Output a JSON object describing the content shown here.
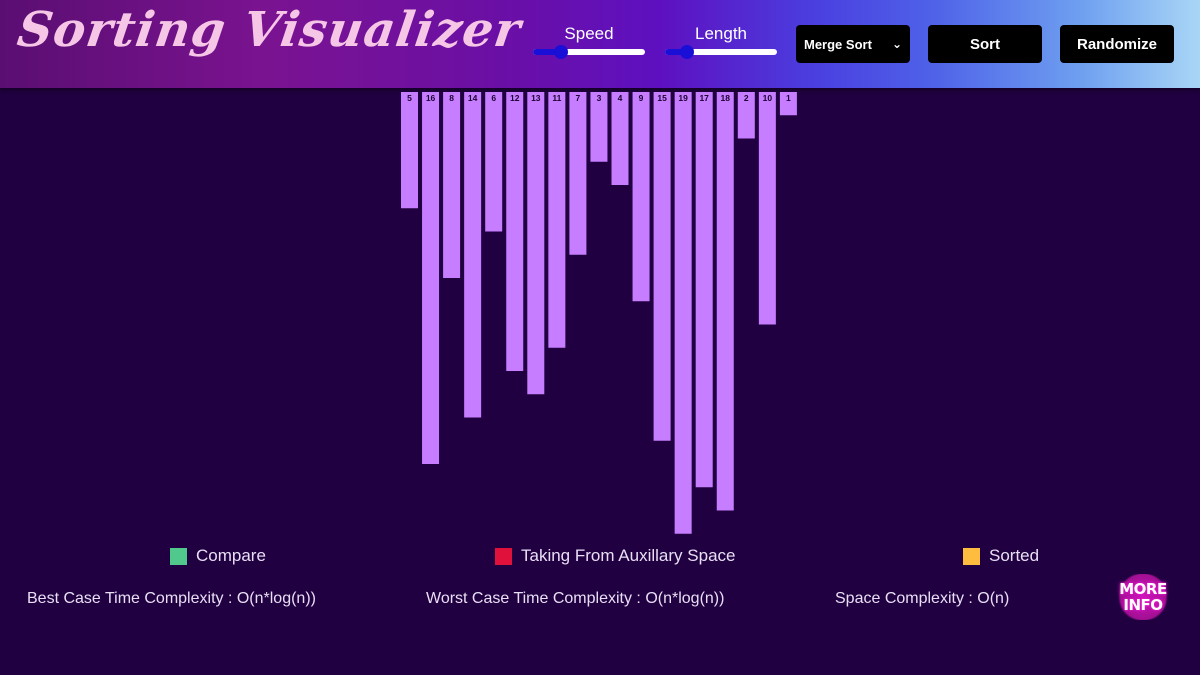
{
  "header": {
    "title": "Sorting Visualizer",
    "speed": {
      "label": "Speed",
      "value": 0.25
    },
    "length": {
      "label": "Length",
      "value": 0.2
    },
    "algorithm_select": {
      "selected": "Merge Sort"
    },
    "sort_label": "Sort",
    "randomize_label": "Randomize"
  },
  "array": {
    "values": [
      5,
      16,
      8,
      14,
      6,
      12,
      13,
      11,
      7,
      3,
      4,
      9,
      15,
      19,
      17,
      18,
      2,
      10,
      1
    ],
    "bar_color": "#c77dff"
  },
  "legend": [
    {
      "label": "Compare",
      "color": "#52c98c"
    },
    {
      "label": "Taking From Auxillary Space",
      "color": "#e0123c"
    },
    {
      "label": "Sorted",
      "color": "#ffbd3f"
    }
  ],
  "complexity": {
    "best": "Best Case Time Complexity : O(n*log(n))",
    "worst": "Worst Case Time Complexity : O(n*log(n))",
    "space": "Space Complexity : O(n)"
  },
  "more_info": {
    "line1": "MORE",
    "line2": "INFO"
  }
}
